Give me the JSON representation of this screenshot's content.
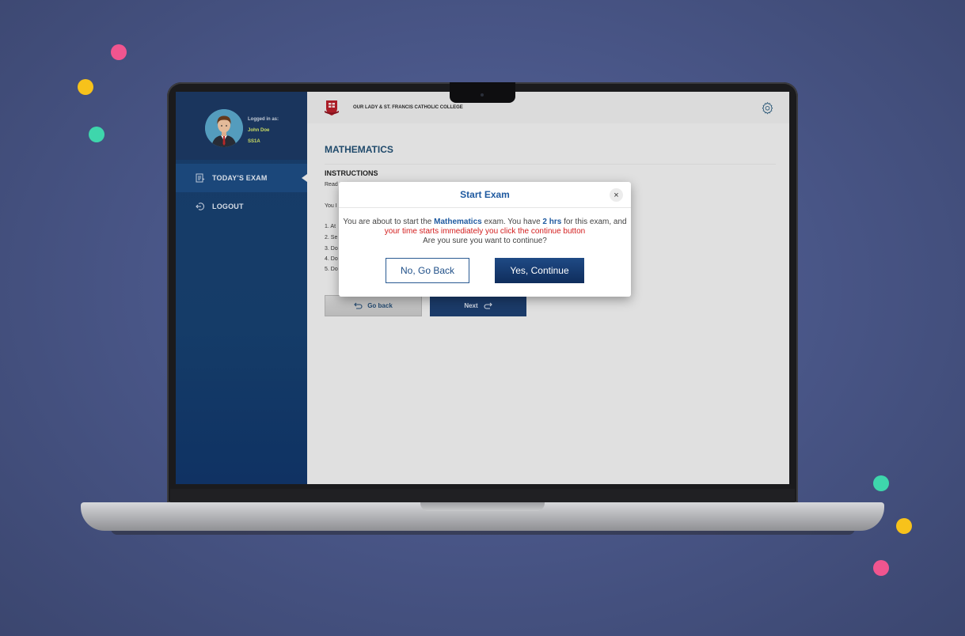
{
  "colors": {
    "pink": "#f0558f",
    "yellow": "#f7c21b",
    "teal": "#3ed6ac",
    "navy": "#1d3f70",
    "link_blue": "#1f5aa0",
    "alert_red": "#d31d1d"
  },
  "profile": {
    "logged_in_label": "Logged in as:",
    "name": "John Doe",
    "class": "SS1A",
    "avatar_icon": "student-avatar"
  },
  "sidebar": {
    "items": [
      {
        "label": "TODAY'S EXAM",
        "icon": "exam-icon",
        "active": true
      },
      {
        "label": "LOGOUT",
        "icon": "logout-icon",
        "active": false
      }
    ]
  },
  "header": {
    "school_name": "OUR LADY & ST. FRANCIS CATHOLIC COLLEGE",
    "logo_icon": "school-crest",
    "settings_icon": "gear-icon"
  },
  "main": {
    "subject": "MATHEMATICS",
    "instructions_title": "INSTRUCTIONS",
    "instruction_lines": [
      "Read",
      "You I",
      "1. At",
      "2. Se",
      "3. Do",
      "4. Do",
      "5. Do"
    ],
    "go_back_label": "Go back",
    "next_label": "Next"
  },
  "modal": {
    "title": "Start Exam",
    "close_symbol": "×",
    "text_1": "You are about to start the ",
    "subject": "Mathematics",
    "text_2": " exam. You have ",
    "duration": "2 hrs",
    "text_3": " for this exam, and ",
    "warning": "your time starts immediately you click the continue button",
    "text_4": "Are you sure you want to continue?",
    "no_label": "No, Go Back",
    "yes_label": "Yes, Continue"
  }
}
